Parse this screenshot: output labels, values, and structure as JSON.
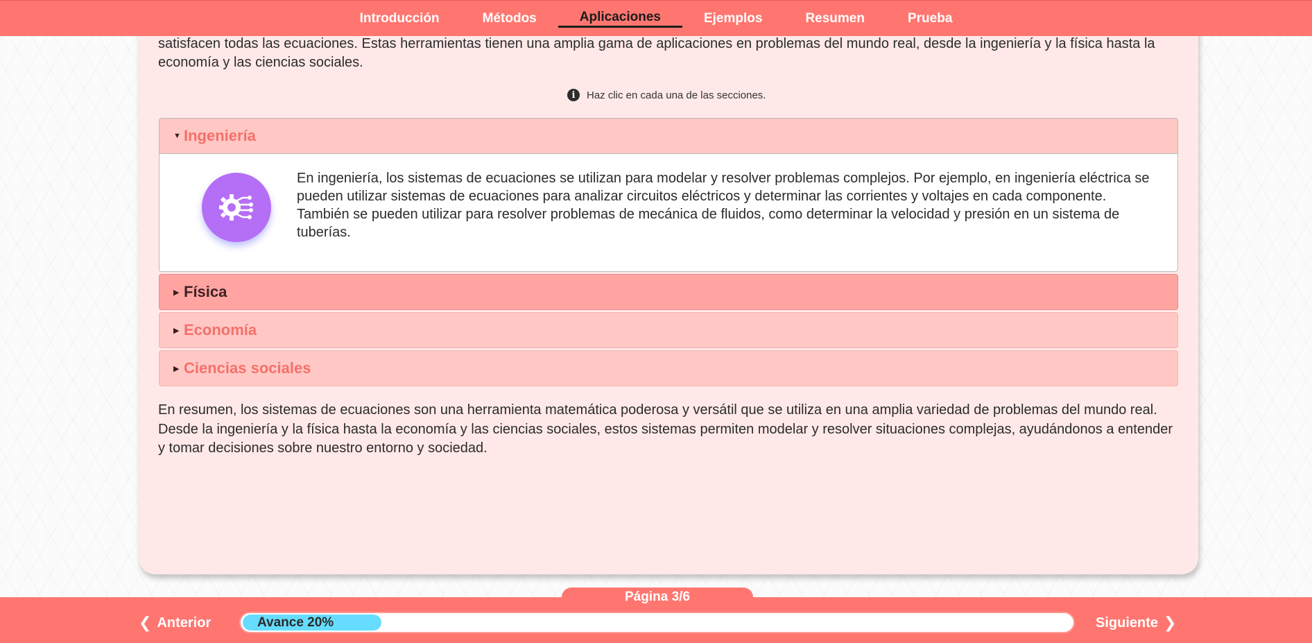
{
  "nav": {
    "items": [
      {
        "label": "Introducción"
      },
      {
        "label": "Métodos"
      },
      {
        "label": "Aplicaciones"
      },
      {
        "label": "Ejemplos"
      },
      {
        "label": "Resumen"
      },
      {
        "label": "Prueba"
      }
    ],
    "active": "Aplicaciones"
  },
  "content": {
    "intro": "satisfacen todas las ecuaciones. Estas herramientas tienen una amplia gama de aplicaciones en problemas del mundo real, desde la ingeniería y la física hasta la economía y las ciencias sociales.",
    "hint": "Haz clic en cada una de las secciones.",
    "accordion": [
      {
        "title": "Ingeniería",
        "expanded": true,
        "icon": "gear-circuit-icon",
        "text": "En ingeniería, los sistemas de ecuaciones se utilizan para modelar y resolver problemas complejos. Por ejemplo, en ingeniería eléctrica se pueden utilizar sistemas de ecuaciones para analizar circuitos eléctricos y determinar las corrientes y voltajes en cada componente. También se pueden utilizar para resolver problemas de mecánica de fluidos, como determinar la velocidad y presión en un sistema de tuberías."
      },
      {
        "title": "Física",
        "expanded": false
      },
      {
        "title": "Economía",
        "expanded": false
      },
      {
        "title": "Ciencias sociales",
        "expanded": false
      }
    ],
    "summary": "En resumen, los sistemas de ecuaciones son una herramienta matemática poderosa y versátil que se utiliza en una amplia variedad de problemas del mundo real. Desde la ingeniería y la física hasta la economía y las ciencias sociales, estos sistemas permiten modelar y resolver situaciones complejas, ayudándonos a entender y tomar decisiones sobre nuestro entorno y sociedad."
  },
  "footer": {
    "page_label": "Página 3/6",
    "prev_label": "Anterior",
    "next_label": "Siguiente",
    "progress_label": "Avance 20%",
    "progress_value": 0.2
  },
  "colors": {
    "brand": "#ff7670",
    "card_bg": "#ffe9e8",
    "accordion_header": "#ffc8c5",
    "accordion_header_hover": "#ffa4a1",
    "accent_text": "#f5706a",
    "icon_bubble": "#b56ef6",
    "progress_fill": "#66dcff"
  }
}
